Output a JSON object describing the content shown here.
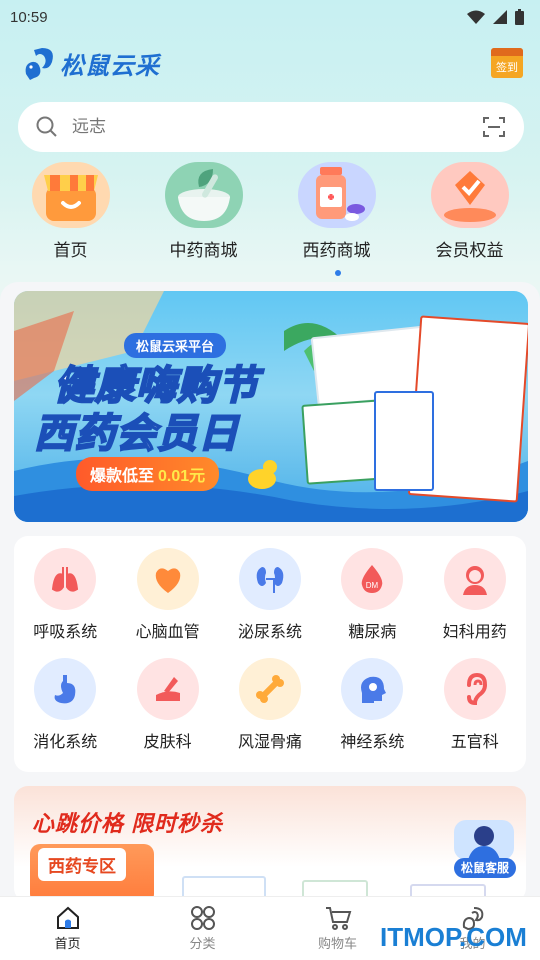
{
  "status": {
    "time": "10:59"
  },
  "app": {
    "logo_text": "松鼠云采",
    "checkin_label": "签到"
  },
  "search": {
    "placeholder": "远志"
  },
  "categories": [
    {
      "label": "首页"
    },
    {
      "label": "中药商城"
    },
    {
      "label": "西药商城"
    },
    {
      "label": "会员权益"
    }
  ],
  "banner": {
    "tag": "松鼠云采平台",
    "title1": "健康嗨购节",
    "title2": "西药会员日",
    "price_prefix": "爆款低至",
    "price": "0.01元"
  },
  "systems": [
    {
      "label": "呼吸系统",
      "color": "#ffe3e3"
    },
    {
      "label": "心脑血管",
      "color": "#fff0d6"
    },
    {
      "label": "泌尿系统",
      "color": "#e1ecff"
    },
    {
      "label": "糖尿病",
      "color": "#ffe3e3"
    },
    {
      "label": "妇科用药",
      "color": "#ffe3e3"
    },
    {
      "label": "消化系统",
      "color": "#e1ecff"
    },
    {
      "label": "皮肤科",
      "color": "#ffe3e3"
    },
    {
      "label": "风湿骨痛",
      "color": "#fff0d6"
    },
    {
      "label": "神经系统",
      "color": "#e1ecff"
    },
    {
      "label": "五官科",
      "color": "#ffe3e3"
    }
  ],
  "promo": {
    "title": "心跳价格 限时秒杀",
    "zone": "西药专区"
  },
  "service": {
    "label": "松鼠客服"
  },
  "tabs": [
    {
      "label": "首页"
    },
    {
      "label": "分类"
    },
    {
      "label": "购物车"
    },
    {
      "label": "我的"
    }
  ],
  "watermark": "ITMOP.COM"
}
